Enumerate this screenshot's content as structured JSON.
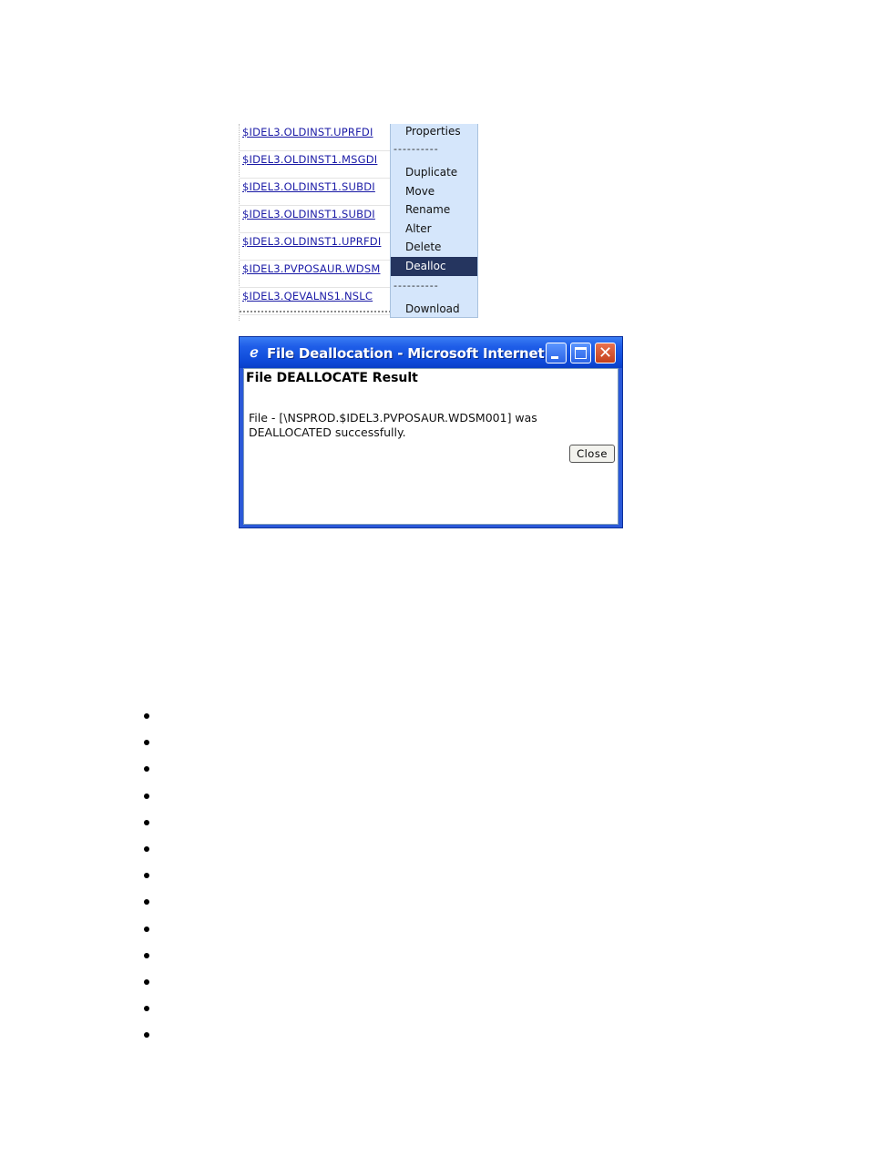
{
  "file_list": {
    "rows": [
      "$IDEL3.OLDINST.UPRFDI",
      "$IDEL3.OLDINST1.MSGDI",
      "$IDEL3.OLDINST1.SUBDI",
      "$IDEL3.OLDINST1.SUBDI",
      "$IDEL3.OLDINST1.UPRFDI",
      "$IDEL3.PVPOSAUR.WDSM",
      "$IDEL3.QEVALNS1.NSLC"
    ]
  },
  "context_menu": {
    "items": [
      {
        "label": "Properties"
      },
      {
        "label": "----------",
        "separator": true
      },
      {
        "label": "Duplicate"
      },
      {
        "label": "Move"
      },
      {
        "label": "Rename"
      },
      {
        "label": "Alter"
      },
      {
        "label": "Delete"
      },
      {
        "label": "Dealloc",
        "selected": true
      },
      {
        "label": "----------",
        "separator": true
      },
      {
        "label": "Download"
      }
    ]
  },
  "dialog": {
    "title": "File Deallocation - Microsoft Internet ...",
    "icon": "ie-page-icon",
    "heading": "File DEALLOCATE Result",
    "message": "File - [\\NSPROD.$IDEL3.PVPOSAUR.WDSM001] was DEALLOCATED successfully.",
    "close_label": "Close"
  },
  "colors": {
    "link": "#1a1aa6",
    "menu_bg": "#d5e6fb",
    "menu_selected": "#25355f",
    "titlebar": "#0d49d8"
  },
  "bullet_count": 13
}
